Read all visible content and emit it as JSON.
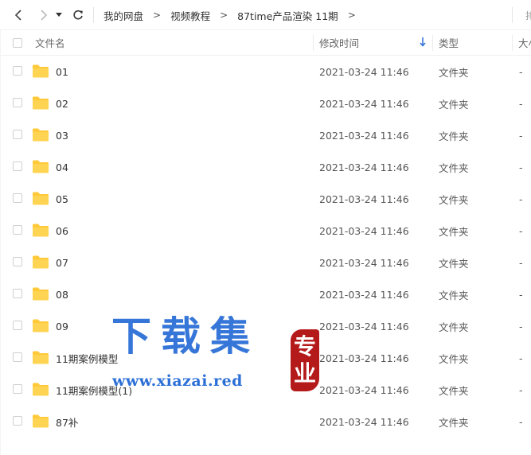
{
  "nav": {
    "back_icon": "chevron-left-icon",
    "forward_icon": "chevron-right-icon",
    "dropdown_icon": "caret-down-icon",
    "refresh_icon": "refresh-icon",
    "breadcrumbs": [
      "我的网盘",
      "视频教程",
      "87time产品渲染 11期"
    ],
    "separator": ">",
    "right_text": "排"
  },
  "table": {
    "columns": {
      "name": "文件名",
      "modified": "修改时间",
      "type": "类型",
      "size": "大小"
    },
    "sort_icon": "arrow-down-icon",
    "rows": [
      {
        "name": "01",
        "date": "2021-03-24 11:46",
        "type": "文件夹",
        "size": "-"
      },
      {
        "name": "02",
        "date": "2021-03-24 11:46",
        "type": "文件夹",
        "size": "-"
      },
      {
        "name": "03",
        "date": "2021-03-24 11:46",
        "type": "文件夹",
        "size": "-"
      },
      {
        "name": "04",
        "date": "2021-03-24 11:46",
        "type": "文件夹",
        "size": "-"
      },
      {
        "name": "05",
        "date": "2021-03-24 11:46",
        "type": "文件夹",
        "size": "-"
      },
      {
        "name": "06",
        "date": "2021-03-24 11:46",
        "type": "文件夹",
        "size": "-"
      },
      {
        "name": "07",
        "date": "2021-03-24 11:46",
        "type": "文件夹",
        "size": "-"
      },
      {
        "name": "08",
        "date": "2021-03-24 11:46",
        "type": "文件夹",
        "size": "-"
      },
      {
        "name": "09",
        "date": "2021-03-24 11:46",
        "type": "文件夹",
        "size": "-"
      },
      {
        "name": "11期案例模型",
        "date": "2021-03-24 11:46",
        "type": "文件夹",
        "size": "-"
      },
      {
        "name": "11期案例模型(1)",
        "date": "2021-03-24 11:46",
        "type": "文件夹",
        "size": "-"
      },
      {
        "name": "87补",
        "date": "2021-03-24 11:46",
        "type": "文件夹",
        "size": "-"
      }
    ]
  },
  "watermark": {
    "title": "下载集",
    "url": "www.xiazai.red",
    "seal_line1": "专",
    "seal_line2": "业"
  },
  "colors": {
    "folder": "#ffc93a",
    "accent": "#2c6fd6",
    "seal": "#b51a1a"
  }
}
